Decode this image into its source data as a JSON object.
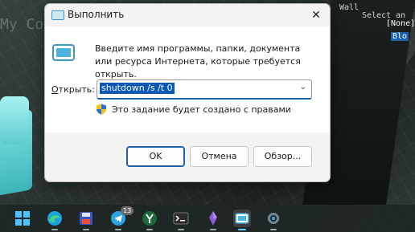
{
  "dialog": {
    "title": "Выполнить",
    "close_glyph": "✕",
    "description": "Введите имя программы, папки, документа или ресурса Интернета, которые требуется открыть.",
    "open_label_prefix": "О",
    "open_label_rest": "ткрыть:",
    "command_value": "shutdown /s /t 0",
    "admin_note": "Это задание будет создано с правами",
    "buttons": {
      "ok": "OK",
      "cancel": "Отмена",
      "browse": "Обзор..."
    }
  },
  "wallpaper": {
    "corner_text": "My Co",
    "panel_lines": [
      "Wall",
      "Select an",
      "[None]",
      "Blo"
    ]
  },
  "taskbar": {
    "telegram_badge": "13",
    "items": [
      "windows-start-icon",
      "edge-icon",
      "save-disk-icon",
      "telegram-icon",
      "kaspersky-icon",
      "terminal-icon",
      "crystal-icon",
      "run-icon",
      "settings-icon"
    ]
  }
}
